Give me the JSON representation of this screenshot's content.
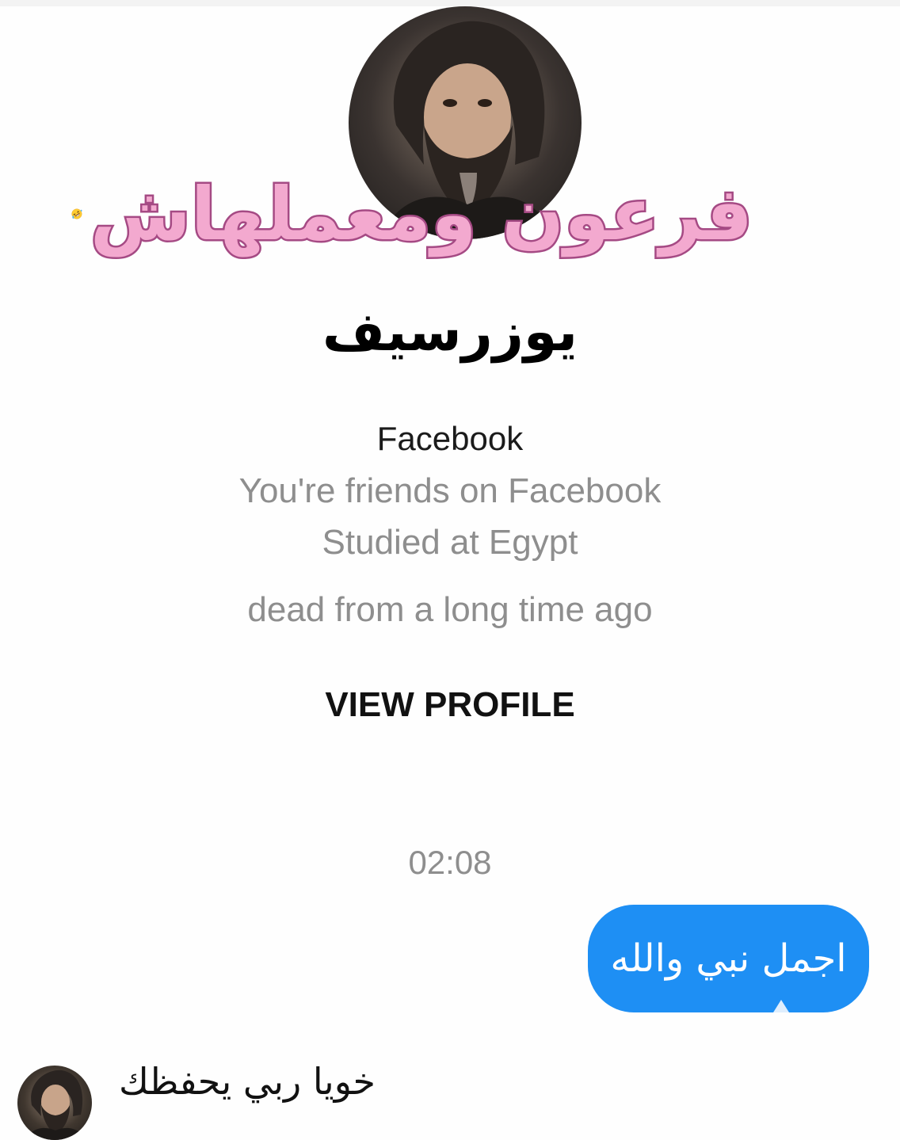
{
  "profile": {
    "avatar_icon": "person-photo-icon",
    "name": "يوزرسيف",
    "platform": "Facebook",
    "friendship": "You're friends on Facebook",
    "education": "Studied at Egypt",
    "extra": "dead from a long time ago",
    "view_profile_label": "VIEW PROFILE"
  },
  "overlay": {
    "caption": "فرعون ومعملهاش",
    "emoji": "rolling-on-floor-laughing-emoji",
    "caption_fill": "#f3a9cf",
    "caption_stroke": "#a54a84"
  },
  "chat": {
    "timestamp": "02:08",
    "sent_message": "اجمل نبي والله",
    "sent_bubble_color": "#1e8ff4",
    "received_message": "خويا ربي يحفظك",
    "sender_avatar_icon": "person-photo-icon"
  }
}
